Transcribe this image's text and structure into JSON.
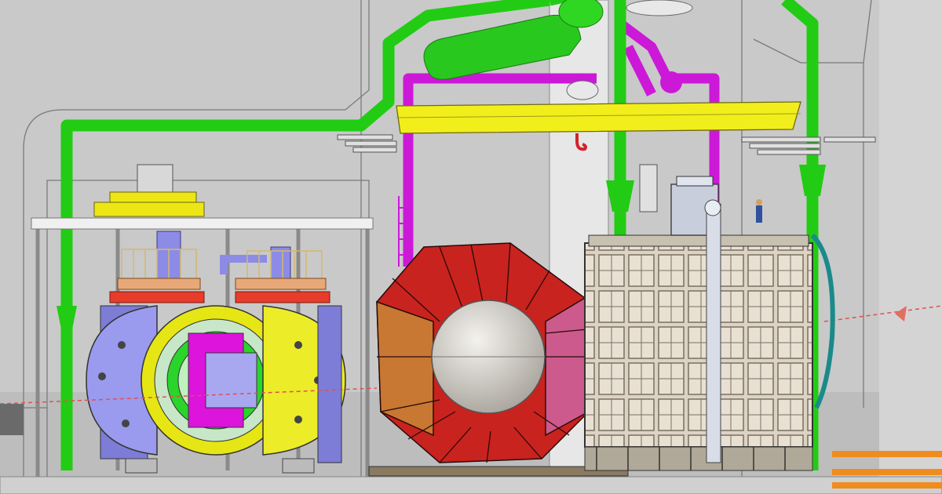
{
  "scene": {
    "view": "cad-cutaway",
    "components": [
      {
        "id": "overhead-crane",
        "color": "#f2ee1c"
      },
      {
        "id": "crane-hook",
        "color": "#d2232a"
      },
      {
        "id": "green-piping",
        "color": "#22cc14"
      },
      {
        "id": "magenta-piping",
        "color": "#cc19d8"
      },
      {
        "id": "red-calorimeter-barrel",
        "color": "#c8231e"
      },
      {
        "id": "orange-calorimeter-segments",
        "color": "#c87832"
      },
      {
        "id": "pink-calorimeter-segments",
        "color": "#cc5a8c"
      },
      {
        "id": "silver-central-sphere",
        "color": "#d4d0c8"
      },
      {
        "id": "blue-magnet-disk",
        "color": "#8c8ce6"
      },
      {
        "id": "yellow-magnet-disk",
        "color": "#e6e614"
      },
      {
        "id": "magenta-magnet-core",
        "color": "#dc14dc"
      },
      {
        "id": "detector-module-grid",
        "color": "#dcd2c3"
      },
      {
        "id": "concrete-pillar",
        "color": "#e6e6e6"
      },
      {
        "id": "orange-beam-pipe",
        "color": "#f08c1e"
      }
    ]
  }
}
